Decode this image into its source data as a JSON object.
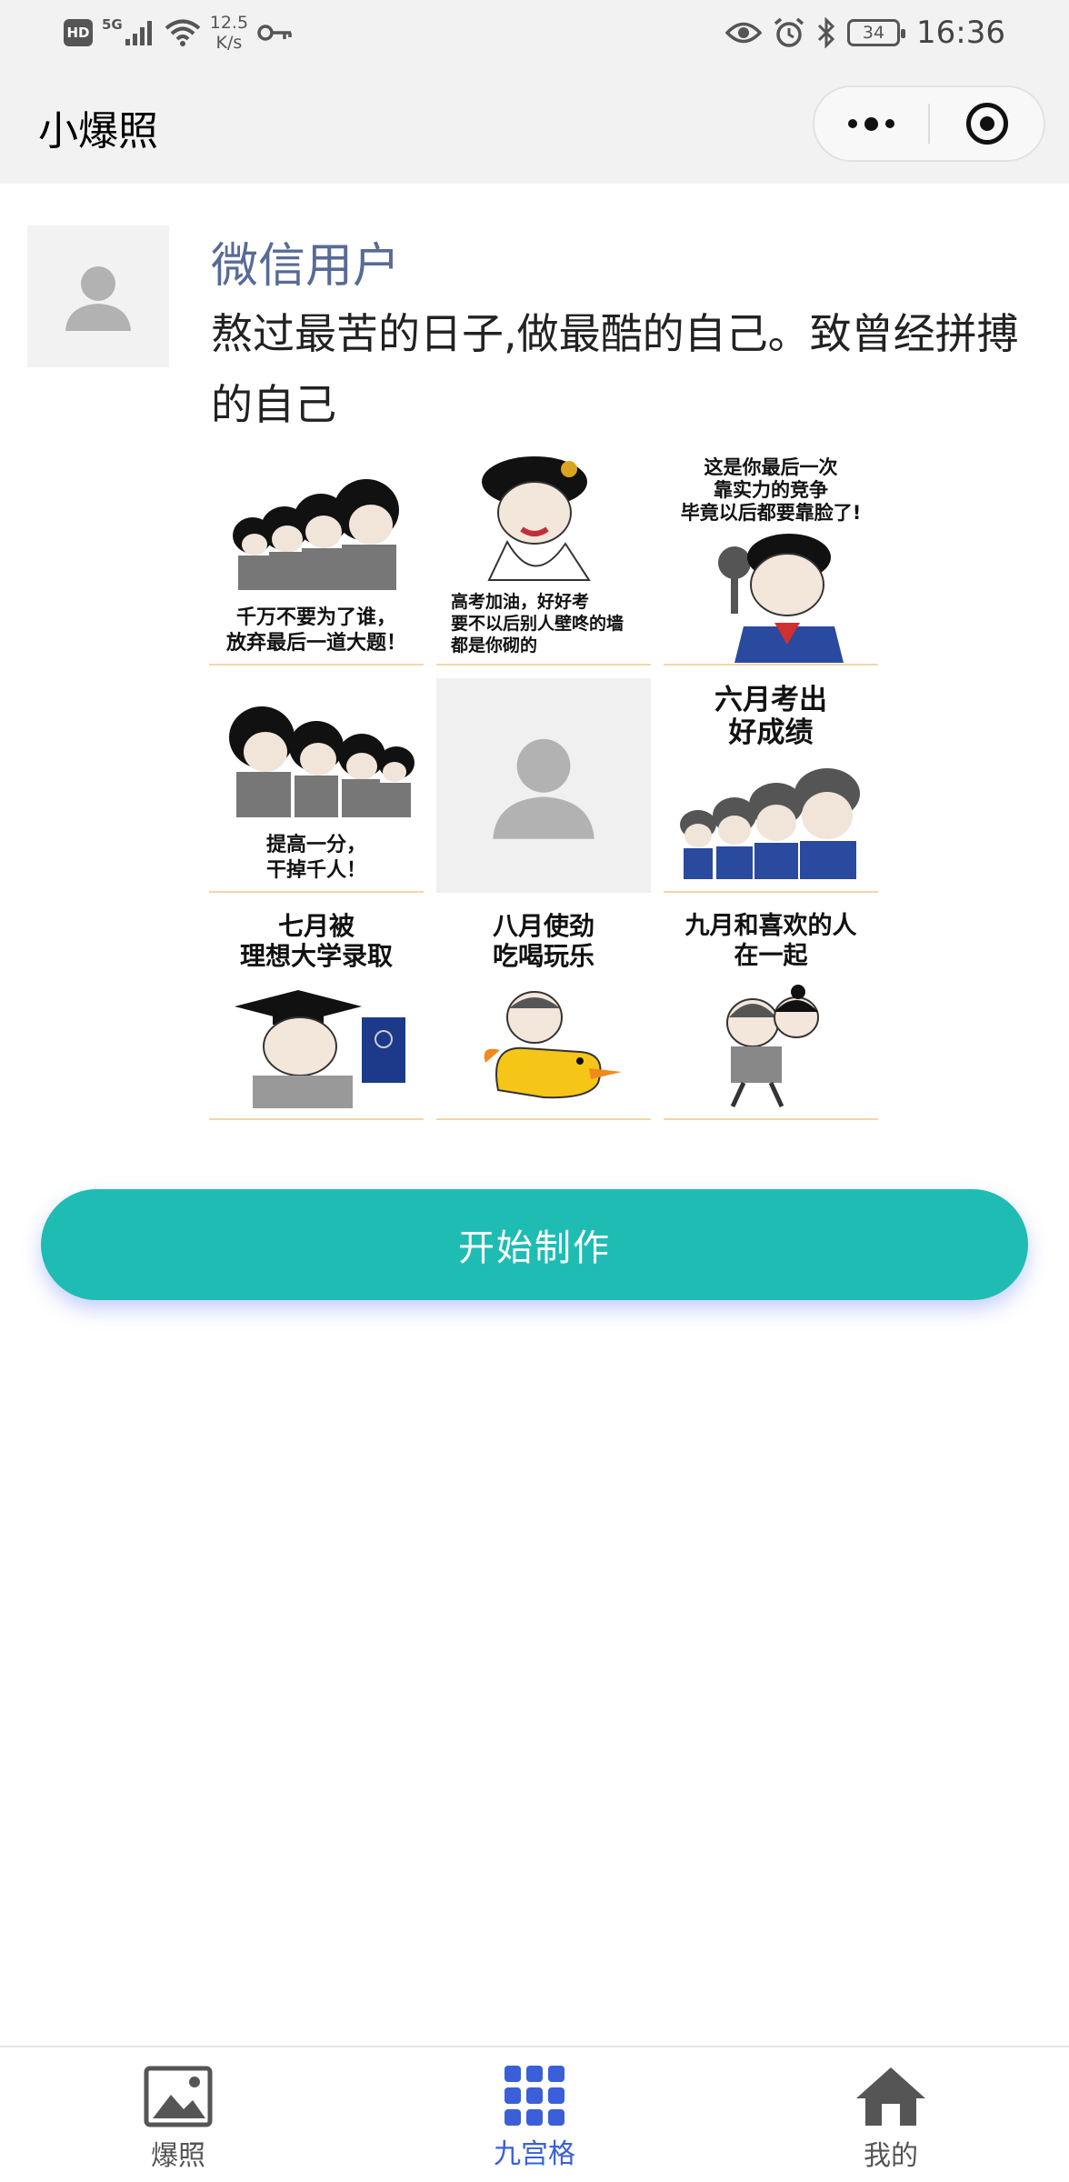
{
  "status_bar": {
    "hd": "HD",
    "network": "5G",
    "speed_value": "12.5",
    "speed_unit": "K/s",
    "battery": "34",
    "time": "16:36"
  },
  "header": {
    "title": "小爆照"
  },
  "post": {
    "username": "微信用户",
    "caption": "熬过最苦的日子,做最酷的自己。致曾经拼搏的自己",
    "images": [
      {
        "text": "千万不要为了谁，\n放弃最后一道大题！"
      },
      {
        "text": "高考加油，好好考\n要不以后别人壁咚的墙\n都是你砌的"
      },
      {
        "text": "这是你最后一次\n靠实力的竞争\n毕竟以后都要靠脸了!"
      },
      {
        "text": "提高一分，\n干掉千人！"
      },
      {
        "text": ""
      },
      {
        "text": "六月考出\n好成绩"
      },
      {
        "text": "七月被\n理想大学录取"
      },
      {
        "text": "八月使劲\n吃喝玩乐"
      },
      {
        "text": "九月和喜欢的人\n在一起"
      }
    ]
  },
  "cta": {
    "label": "开始制作"
  },
  "tabs": [
    {
      "label": "爆照",
      "icon": "image-icon",
      "active": false
    },
    {
      "label": "九宫格",
      "icon": "grid-icon",
      "active": true
    },
    {
      "label": "我的",
      "icon": "home-icon",
      "active": false
    }
  ],
  "colors": {
    "accent": "#1fbcb4",
    "tab_active": "#3a5fd8",
    "username": "#576b95",
    "bar_bg": "#f2f2f2"
  }
}
